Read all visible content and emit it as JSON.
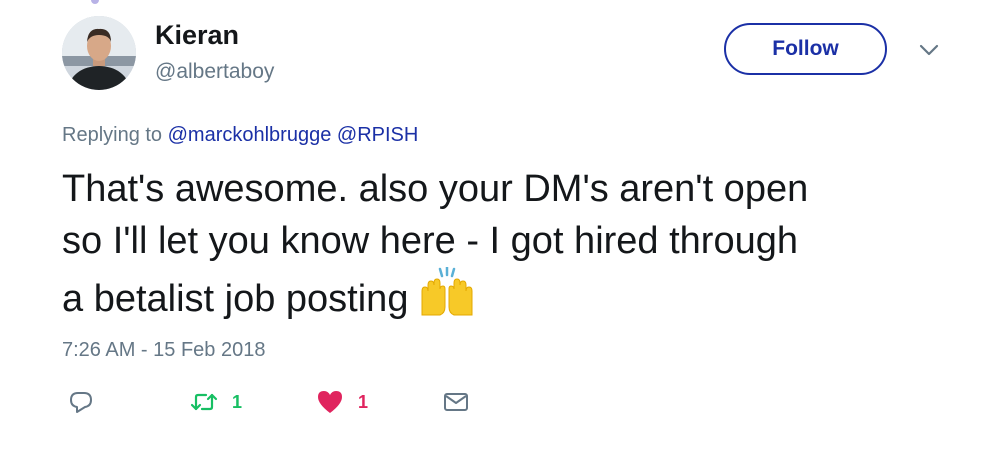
{
  "author": {
    "name": "Kieran",
    "handle": "@albertaboy",
    "avatar_icon": "user-avatar-photo"
  },
  "follow_button": {
    "label": "Follow",
    "color": "#1b30a6"
  },
  "menu": {
    "icon": "chevron-down-icon"
  },
  "reply_context": {
    "prefix": "Replying to",
    "mentions": [
      "@marckohlbrugge",
      "@RPISH"
    ],
    "link_color": "#1b30a6"
  },
  "tweet": {
    "lines": [
      "That's awesome. also your DM's aren't open",
      "so I'll let you know here - I got hired through",
      "a betalist job posting"
    ],
    "emoji": "raising-hands-emoji",
    "timestamp": "7:26 AM - 15 Feb 2018"
  },
  "actions": {
    "reply": {
      "icon": "reply-icon",
      "count": ""
    },
    "retweet": {
      "icon": "retweet-icon",
      "count": "1",
      "color": "#17bf63"
    },
    "like": {
      "icon": "heart-icon",
      "count": "1",
      "color": "#e0245e"
    },
    "message": {
      "icon": "envelope-icon",
      "count": ""
    }
  }
}
